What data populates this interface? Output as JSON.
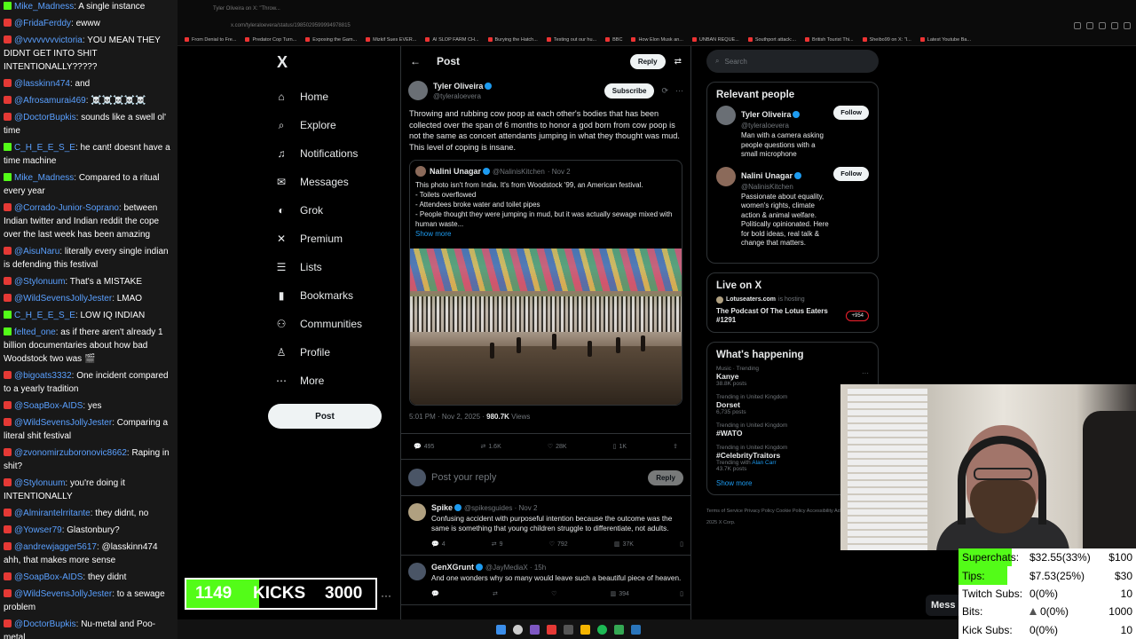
{
  "chat": [
    {
      "platform": "kick",
      "user": "Mike_Madness",
      "text": "A single instance",
      "color": "#5aa0ff"
    },
    {
      "platform": "yt",
      "user": "@FridaFerddy",
      "text": "ewww",
      "color": "#5aa0ff"
    },
    {
      "platform": "yt",
      "user": "@vvvvvvvvictoria",
      "text": "YOU MEAN THEY DIDNT GET INTO SHIT INTENTIONALLY?????",
      "color": "#5aa0ff"
    },
    {
      "platform": "yt",
      "user": "@lasskinn474",
      "text": "and",
      "color": "#5aa0ff"
    },
    {
      "platform": "yt",
      "user": "@Afrosamurai469",
      "text": "☠️☠️☠️☠️☠️",
      "color": "#5aa0ff"
    },
    {
      "platform": "yt",
      "user": "@DoctorBupkis",
      "text": "sounds like a swell ol' time",
      "color": "#5aa0ff"
    },
    {
      "platform": "kick",
      "user": "C_H_E_E_S_E",
      "text": "he cant! doesnt have a time machine",
      "color": "#5aa0ff"
    },
    {
      "platform": "kick",
      "user": "Mike_Madness",
      "text": "Compared to a ritual every year",
      "color": "#5aa0ff"
    },
    {
      "platform": "yt",
      "user": "@Corrado-Junior-Soprano",
      "text": "between Indian twitter and Indian reddit the cope over the last week has been amazing",
      "color": "#5aa0ff"
    },
    {
      "platform": "yt",
      "user": "@AisuNaru",
      "text": "literally every single indian is defending this festival",
      "color": "#5aa0ff"
    },
    {
      "platform": "yt",
      "user": "@Stylonuum",
      "text": "That's a MISTAKE",
      "color": "#5aa0ff"
    },
    {
      "platform": "yt",
      "user": "@WildSevensJollyJester",
      "text": "LMAO",
      "color": "#5aa0ff"
    },
    {
      "platform": "kick",
      "user": "C_H_E_E_S_E",
      "text": "LOW IQ INDIAN",
      "color": "#5aa0ff"
    },
    {
      "platform": "kick",
      "user": "felted_one",
      "text": "as if there aren't already 1 billion documentaries about how bad Woodstock two was 🎬",
      "color": "#5aa0ff"
    },
    {
      "platform": "yt",
      "user": "@bigoats3332",
      "text": "One incident compared to a yearly tradition",
      "color": "#5aa0ff"
    },
    {
      "platform": "yt",
      "user": "@SoapBox-AIDS",
      "text": "yes",
      "color": "#5aa0ff"
    },
    {
      "platform": "yt",
      "user": "@WildSevensJollyJester",
      "text": "Comparing a literal shit festival",
      "color": "#5aa0ff"
    },
    {
      "platform": "yt",
      "user": "@zvonomirzuboronovic8662",
      "text": "Raping in shit?",
      "color": "#5aa0ff"
    },
    {
      "platform": "yt",
      "user": "@Stylonuum",
      "text": "you're doing it INTENTIONALLY",
      "color": "#5aa0ff"
    },
    {
      "platform": "yt",
      "user": "@Almirantelrritante",
      "text": "they didnt, no",
      "color": "#5aa0ff"
    },
    {
      "platform": "yt",
      "user": "@Yowser79",
      "text": "Glastonbury?",
      "color": "#5aa0ff"
    },
    {
      "platform": "yt",
      "user": "@andrewjagger5617",
      "text": "@lasskinn474 ahh, that makes more sense",
      "color": "#5aa0ff"
    },
    {
      "platform": "yt",
      "user": "@SoapBox-AIDS",
      "text": "they didnt",
      "color": "#5aa0ff"
    },
    {
      "platform": "yt",
      "user": "@WildSevensJollyJester",
      "text": "to a sewage problem",
      "color": "#5aa0ff"
    },
    {
      "platform": "yt",
      "user": "@DoctorBupkis",
      "text": "Nu-metal and Poo-metal",
      "color": "#5aa0ff"
    }
  ],
  "browser": {
    "tab_title": "Tyler Oliveira on X: \"Throw...",
    "url": "x.com/tyleraloevera/status/1985029599994978815",
    "bookmarks": [
      "From Denial to Fre...",
      "Predator Cop Turn...",
      "Exposing the Gam...",
      "Mizkif Sues EVER...",
      "AI SLOP FARM CH...",
      "Burying the Hatch...",
      "Testing out our hu...",
      "BBC",
      "How Elon Musk an...",
      "UNBAN REQUE...",
      "Southport attack:...",
      "British Tourist Thi...",
      "Sheibo99 on X: \"I...",
      "Latest Youtube Ba..."
    ]
  },
  "nav": {
    "logo": "X",
    "items": [
      {
        "label": "Home",
        "icon": "⌂",
        "name": "home"
      },
      {
        "label": "Explore",
        "icon": "⌕",
        "name": "explore"
      },
      {
        "label": "Notifications",
        "icon": "♫",
        "name": "notifications"
      },
      {
        "label": "Messages",
        "icon": "✉",
        "name": "messages"
      },
      {
        "label": "Grok",
        "icon": "◐",
        "name": "grok"
      },
      {
        "label": "Premium",
        "icon": "✕",
        "name": "premium"
      },
      {
        "label": "Lists",
        "icon": "☰",
        "name": "lists"
      },
      {
        "label": "Bookmarks",
        "icon": "▮",
        "name": "bookmarks"
      },
      {
        "label": "Communities",
        "icon": "⚇",
        "name": "communities"
      },
      {
        "label": "Profile",
        "icon": "♙",
        "name": "profile"
      },
      {
        "label": "More",
        "icon": "⋯",
        "name": "more"
      }
    ],
    "post_label": "Post"
  },
  "main": {
    "title": "Post",
    "reply_pill": "Reply",
    "author": {
      "name": "Tyler Oliveira",
      "handle": "@tyleraloevera",
      "subscribe": "Subscribe"
    },
    "text": "Throwing and rubbing cow poop at each other's bodies that has been collected over the span of 6 months to honor a god born from cow poop is not the same as concert attendants jumping in what they thought was mud. This level of coping is insane.",
    "quote": {
      "name": "Nalini Unagar",
      "handle": "@NalinisKitchen",
      "date": "· Nov 2",
      "text": "This photo isn't from India. It's from Woodstock '99, an American festival.\n- Toilets overflowed\n- Attendees broke water and toilet pipes\n- People thought they were jumping in mud, but it was actually sewage mixed with human waste...",
      "show_more": "Show more"
    },
    "time": "5:01 PM · Nov 2, 2025 · ",
    "views": "980.7K",
    "views_label": " Views",
    "stats": {
      "replies": "495",
      "reposts": "1.6K",
      "likes": "28K",
      "bookmarks": "1K"
    },
    "reply_placeholder": "Post your reply",
    "reply_button": "Reply",
    "replies": [
      {
        "name": "Spike",
        "handle": "@spikesguides · Nov 2",
        "text": "Confusing accident with purposeful intention because the outcome was the same is something that young children struggle to differentiate, not adults.",
        "replies": "4",
        "reposts": "9",
        "likes": "792",
        "views": "37K"
      },
      {
        "name": "GenXGrunt",
        "handle": "@JayMediaX · 15h",
        "text": "And one wonders why so many would leave such a beautiful piece of heaven.",
        "replies": "",
        "reposts": "",
        "likes": "",
        "views": "394"
      }
    ]
  },
  "right": {
    "search_placeholder": "Search",
    "relevant_title": "Relevant people",
    "people": [
      {
        "name": "Tyler Oliveira",
        "handle": "@tyleraloevera",
        "desc": "Man with a camera asking people questions with a small microphone",
        "follow": "Follow"
      },
      {
        "name": "Nalini Unagar",
        "handle": "@NalinisKitchen",
        "desc": "Passionate about equality, women's rights, climate action & animal welfare. Politically opinionated. Here for bold ideas, real talk & change that matters.",
        "follow": "Follow"
      }
    ],
    "live_title": "Live on X",
    "live_host": "Lotuseaters.com",
    "live_host_suffix": "is hosting",
    "live_show": "The Podcast Of The Lotus Eaters #1291",
    "live_count": "+954",
    "happening_title": "What's happening",
    "trends": [
      {
        "ctx": "Music · Trending",
        "name": "Kanye",
        "count": "38.8K posts"
      },
      {
        "ctx": "Trending in United Kingdom",
        "name": "Dorset",
        "count": "6,735 posts"
      },
      {
        "ctx": "Trending in United Kingdom",
        "name": "#WATO",
        "count": ""
      },
      {
        "ctx": "Trending in United Kingdom",
        "name": "#CelebrityTraitors",
        "count": "43.7K posts",
        "link": "Alan Carr",
        "link_prefix": "Trending with "
      }
    ],
    "show_more": "Show more",
    "footer": "Terms of Service   Privacy Policy   Cookie Policy   Accessibility   Ads info   More ···   © 2025 X Corp."
  },
  "kicks": {
    "current": "1149",
    "label": "KICKS",
    "goal": "3000",
    "progress": 0.383
  },
  "stats_panel": [
    {
      "label": "Superchats:",
      "value": "$32.55(33%)",
      "goal": "$100",
      "progress": 0.33
    },
    {
      "label": "Tips:",
      "value": "$7.53(25%)",
      "goal": "$30",
      "progress": 0.25
    },
    {
      "label": "Twitch Subs:",
      "value": "0(0%)",
      "goal": "10",
      "progress": 0
    },
    {
      "label": "Bits:",
      "value": "0(0%)",
      "goal": "1000",
      "progress": 0
    },
    {
      "label": "Kick Subs:",
      "value": "0(0%)",
      "goal": "10",
      "progress": 0
    }
  ],
  "messages_button": "Mess",
  "colors": {
    "accent": "#1d9bf0",
    "kick_green": "#53fc18",
    "yt_red": "#e53935"
  }
}
